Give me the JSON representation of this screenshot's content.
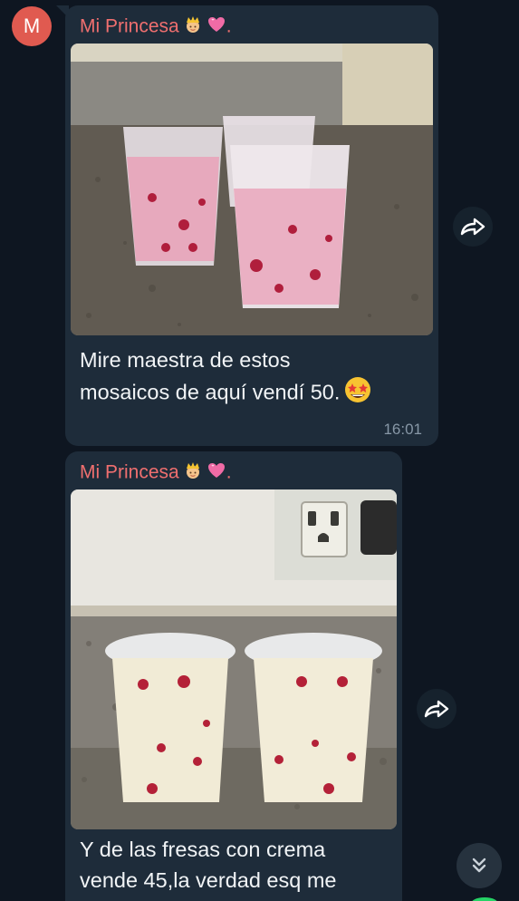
{
  "sender": {
    "avatar_letter": "M",
    "name": "Mi Princesa",
    "name_suffix": "."
  },
  "messages": [
    {
      "caption_lines": [
        "Mire maestra de estos",
        "mosaicos de aquí vendí 50."
      ],
      "time": "16:01"
    },
    {
      "caption_lines": [
        "Y de las fresas con crema",
        "vende 45,la verdad esq  me"
      ]
    }
  ],
  "colors": {
    "background": "#0e1621",
    "bubble": "#1e2c3a",
    "sender_name": "#ef6f6f",
    "avatar": "#e05a50",
    "timestamp": "#8797a6"
  },
  "icons": [
    "princess-emoji-icon",
    "pink-heart-emoji-icon",
    "star-struck-emoji-icon",
    "forward-icon",
    "chevron-double-down-icon"
  ]
}
